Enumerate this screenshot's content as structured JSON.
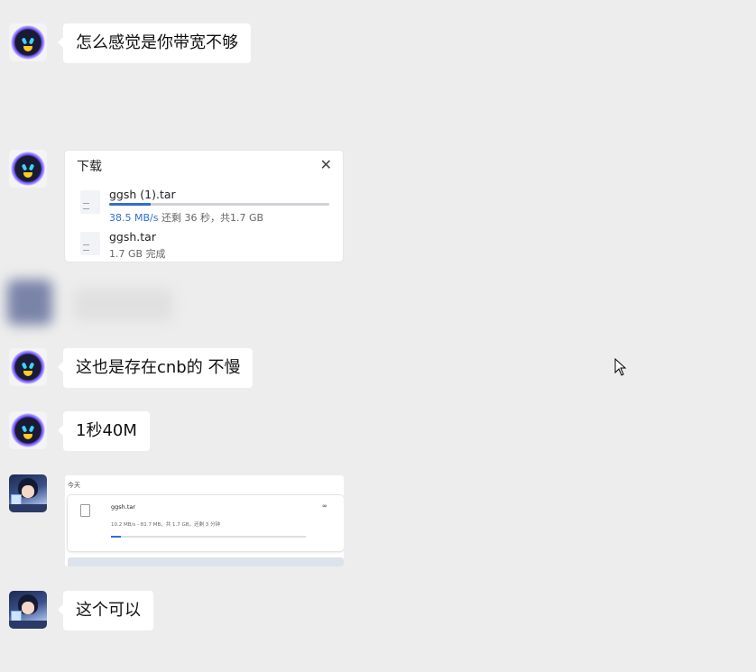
{
  "messages": [
    {
      "sender": "bot",
      "text": "怎么感觉是你带宽不够"
    },
    {
      "sender": "bot",
      "type": "download-card"
    },
    {
      "sender": "bot",
      "text": "这也是存在cnb的 不慢"
    },
    {
      "sender": "bot",
      "text": "1秒40M"
    },
    {
      "sender": "anime",
      "type": "screenshot"
    },
    {
      "sender": "anime",
      "text": "这个可以"
    }
  ],
  "download_card": {
    "title": "下载",
    "close_icon": "✕",
    "items": [
      {
        "name": "ggsh (1).tar",
        "speed": "38.5 MB/s",
        "status": "还剩 36 秒，共1.7 GB",
        "progress": 0.19
      },
      {
        "name": "ggsh.tar",
        "size": "1.7 GB",
        "status": "完成"
      }
    ]
  },
  "screenshot": {
    "today": "今天",
    "file_name": "ggsh.tar",
    "meta": "10.2 MB/s - 81.7 MB，共 1.7 GB，还剩 3 分钟",
    "progress": 0.05,
    "link_icon": "∞",
    "more_icon": "⋮"
  },
  "colors": {
    "background": "#ededed",
    "bubble": "#ffffff",
    "accent": "#2f6fcc"
  }
}
